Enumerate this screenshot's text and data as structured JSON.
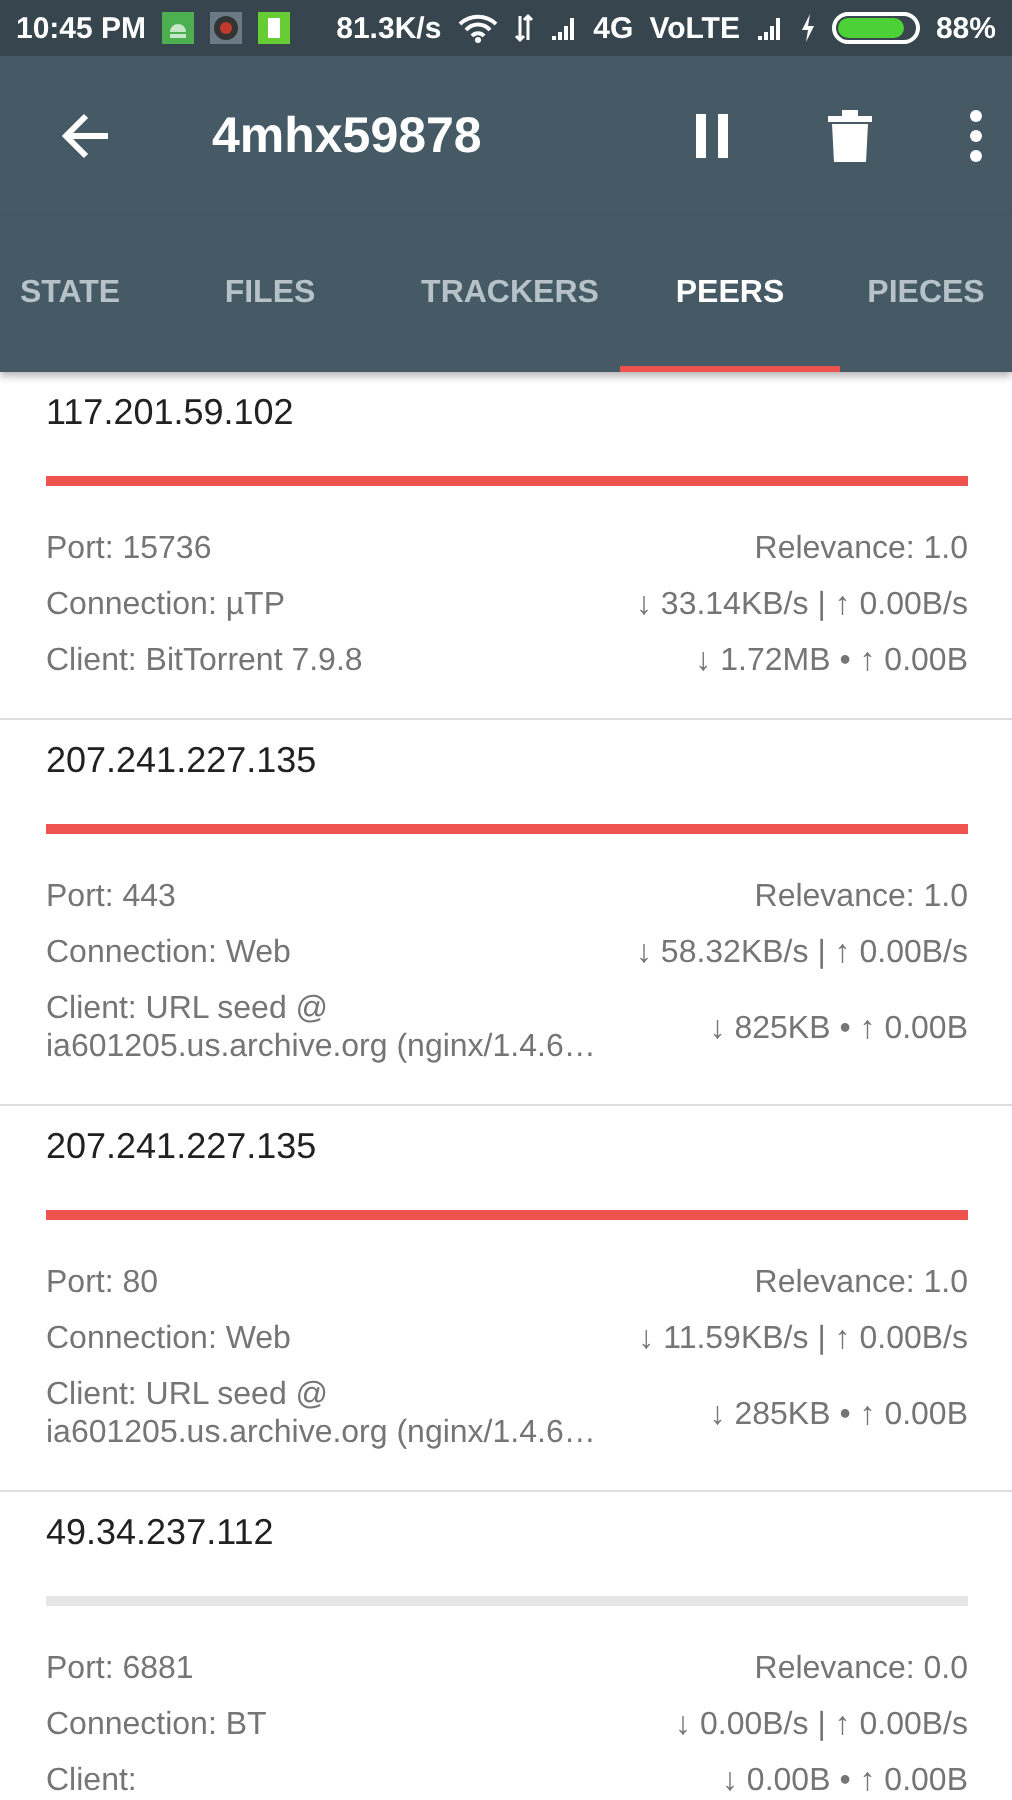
{
  "status_bar": {
    "time": "10:45 PM",
    "speed": "81.3K/s",
    "network": "4G",
    "volte": "VoLTE",
    "battery": "88%"
  },
  "toolbar": {
    "title": "4mhx59878"
  },
  "tabs": [
    {
      "label": "STATE",
      "selected": false
    },
    {
      "label": "FILES",
      "selected": false
    },
    {
      "label": "TRACKERS",
      "selected": false
    },
    {
      "label": "PEERS",
      "selected": true
    },
    {
      "label": "PIECES",
      "selected": false
    }
  ],
  "peers": [
    {
      "ip": "117.201.59.102",
      "level": 1.0,
      "port": "Port: 15736",
      "relevance": "Relevance: 1.0",
      "connection": "Connection: µTP",
      "speed": "↓ 33.14KB/s | ↑ 0.00B/s",
      "client": "Client: BitTorrent 7.9.8",
      "transferred": "↓ 1.72MB • ↑ 0.00B"
    },
    {
      "ip": "207.241.227.135",
      "level": 1.0,
      "port": "Port: 443",
      "relevance": "Relevance: 1.0",
      "connection": "Connection: Web",
      "speed": "↓ 58.32KB/s | ↑ 0.00B/s",
      "client": "Client: URL seed @ ia601205.us.archive.org (nginx/1.4.6…",
      "transferred": "↓ 825KB • ↑ 0.00B"
    },
    {
      "ip": "207.241.227.135",
      "level": 1.0,
      "port": "Port: 80",
      "relevance": "Relevance: 1.0",
      "connection": "Connection: Web",
      "speed": "↓ 11.59KB/s | ↑ 0.00B/s",
      "client": "Client: URL seed @ ia601205.us.archive.org (nginx/1.4.6…",
      "transferred": "↓ 285KB • ↑ 0.00B"
    },
    {
      "ip": "49.34.237.112",
      "level": 0.0,
      "port": "Port: 6881",
      "relevance": "Relevance: 0.0",
      "connection": "Connection: BT",
      "speed": "↓ 0.00B/s | ↑ 0.00B/s",
      "client": "Client:",
      "transferred": "↓ 0.00B • ↑ 0.00B"
    }
  ]
}
